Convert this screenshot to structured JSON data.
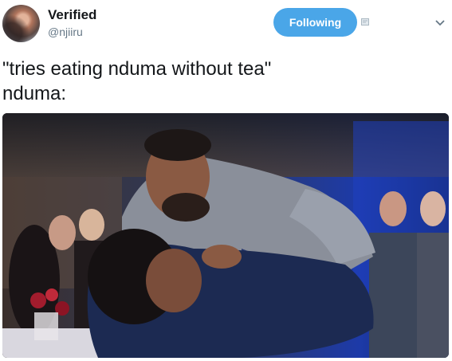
{
  "tweet": {
    "display_name": "Verified",
    "handle": "@njiiru",
    "text": "\"tries eating nduma without tea\"\nnduma:",
    "follow_label": "Following"
  },
  "icons": {
    "avatar": "avatar",
    "message": "direct-message-icon",
    "menu": "chevron-down-icon"
  },
  "colors": {
    "follow_button": "#4aa6e8",
    "handle": "#657786"
  }
}
